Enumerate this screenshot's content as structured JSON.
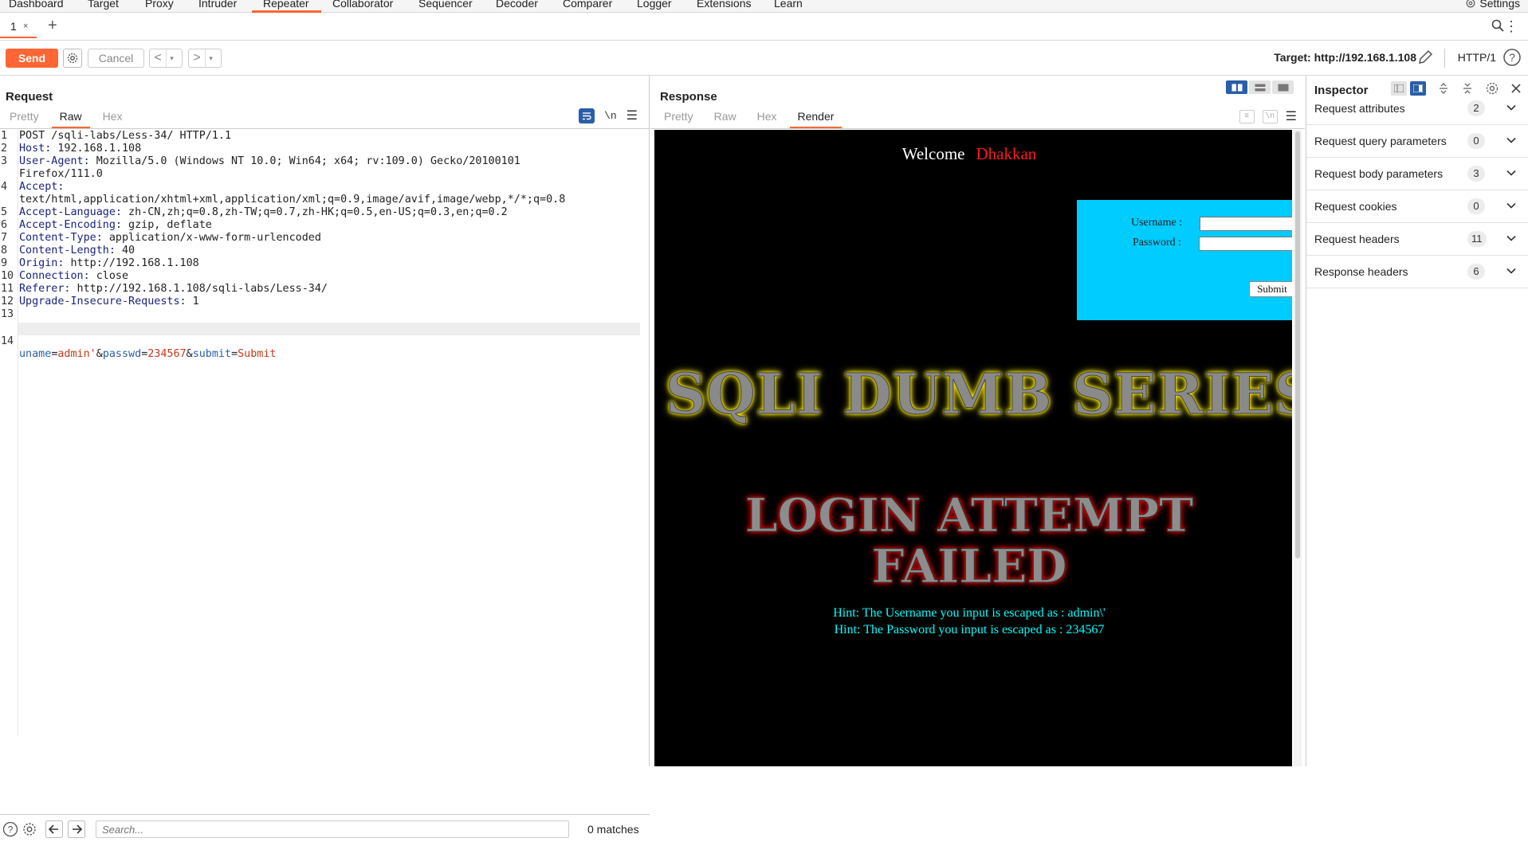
{
  "menu": {
    "items": [
      "Dashboard",
      "Target",
      "Proxy",
      "Intruder",
      "Repeater",
      "Collaborator",
      "Sequencer",
      "Decoder",
      "Comparer",
      "Logger",
      "Extensions",
      "Learn"
    ],
    "active": "Repeater",
    "settings_label": "Settings"
  },
  "tabs": {
    "current": "1",
    "close": "×",
    "add": "+"
  },
  "toolbar": {
    "send": "Send",
    "cancel": "Cancel",
    "prev": "<",
    "next": ">",
    "dropdown": "▾",
    "target": "Target: http://192.168.1.108",
    "protocol": "HTTP/1"
  },
  "request": {
    "title": "Request",
    "tabs": [
      "Pretty",
      "Raw",
      "Hex"
    ],
    "active_tab": "Raw",
    "ln_toggle": "\\n",
    "lines": [
      {
        "n": "1",
        "key": "",
        "val": "POST /sqli-labs/Less-34/ HTTP/1.1"
      },
      {
        "n": "2",
        "key": "Host:",
        "val": " 192.168.1.108"
      },
      {
        "n": "3",
        "key": "User-Agent:",
        "val": " Mozilla/5.0 (Windows NT 10.0; Win64; x64; rv:109.0) Gecko/20100101"
      },
      {
        "n": "",
        "key": "",
        "val": "Firefox/111.0"
      },
      {
        "n": "4",
        "key": "Accept:",
        "val": ""
      },
      {
        "n": "",
        "key": "",
        "val": "text/html,application/xhtml+xml,application/xml;q=0.9,image/avif,image/webp,*/*;q=0.8"
      },
      {
        "n": "5",
        "key": "Accept-Language:",
        "val": " zh-CN,zh;q=0.8,zh-TW;q=0.7,zh-HK;q=0.5,en-US;q=0.3,en;q=0.2"
      },
      {
        "n": "6",
        "key": "Accept-Encoding:",
        "val": " gzip, deflate"
      },
      {
        "n": "7",
        "key": "Content-Type:",
        "val": " application/x-www-form-urlencoded"
      },
      {
        "n": "8",
        "key": "Content-Length:",
        "val": " 40"
      },
      {
        "n": "9",
        "key": "Origin:",
        "val": " http://192.168.1.108"
      },
      {
        "n": "10",
        "key": "Connection:",
        "val": " close"
      },
      {
        "n": "11",
        "key": "Referer:",
        "val": " http://192.168.1.108/sqli-labs/Less-34/"
      },
      {
        "n": "12",
        "key": "Upgrade-Insecure-Requests:",
        "val": " 1"
      },
      {
        "n": "13",
        "key": "",
        "val": ""
      }
    ],
    "body_line": {
      "n": "14",
      "p1": "uname",
      "eq1": "=",
      "v1": "admin'",
      "amp1": "&",
      "p2": "passwd",
      "eq2": "=",
      "v2": "234567",
      "amp2": "&",
      "p3": "submit",
      "eq3": "=",
      "v3": "Submit"
    },
    "search_placeholder": "Search...",
    "matches": "0 matches"
  },
  "response": {
    "title": "Response",
    "tabs": [
      "Pretty",
      "Raw",
      "Hex",
      "Render"
    ],
    "active_tab": "Render",
    "render": {
      "welcome": "Welcome",
      "name": "Dhakkan",
      "username_label": "Username :",
      "password_label": "Password :",
      "submit": "Submit",
      "banner": "SQLI DUMB SERIES",
      "fail_line1": "LOGIN ATTEMPT",
      "fail_line2": "FAILED",
      "hint1": "Hint: The Username you input is escaped as : admin\\'",
      "hint2": "Hint: The Password you input is escaped as : 234567"
    }
  },
  "inspector": {
    "title": "Inspector",
    "rows": [
      {
        "label": "Request attributes",
        "count": "2"
      },
      {
        "label": "Request query parameters",
        "count": "0"
      },
      {
        "label": "Request body parameters",
        "count": "3"
      },
      {
        "label": "Request cookies",
        "count": "0"
      },
      {
        "label": "Request headers",
        "count": "11"
      },
      {
        "label": "Response headers",
        "count": "6"
      }
    ]
  },
  "colors": {
    "accent": "#ff6633",
    "selected_blue": "#2a5ea8",
    "login_box": "#00ccff",
    "hint": "#00ffff"
  }
}
